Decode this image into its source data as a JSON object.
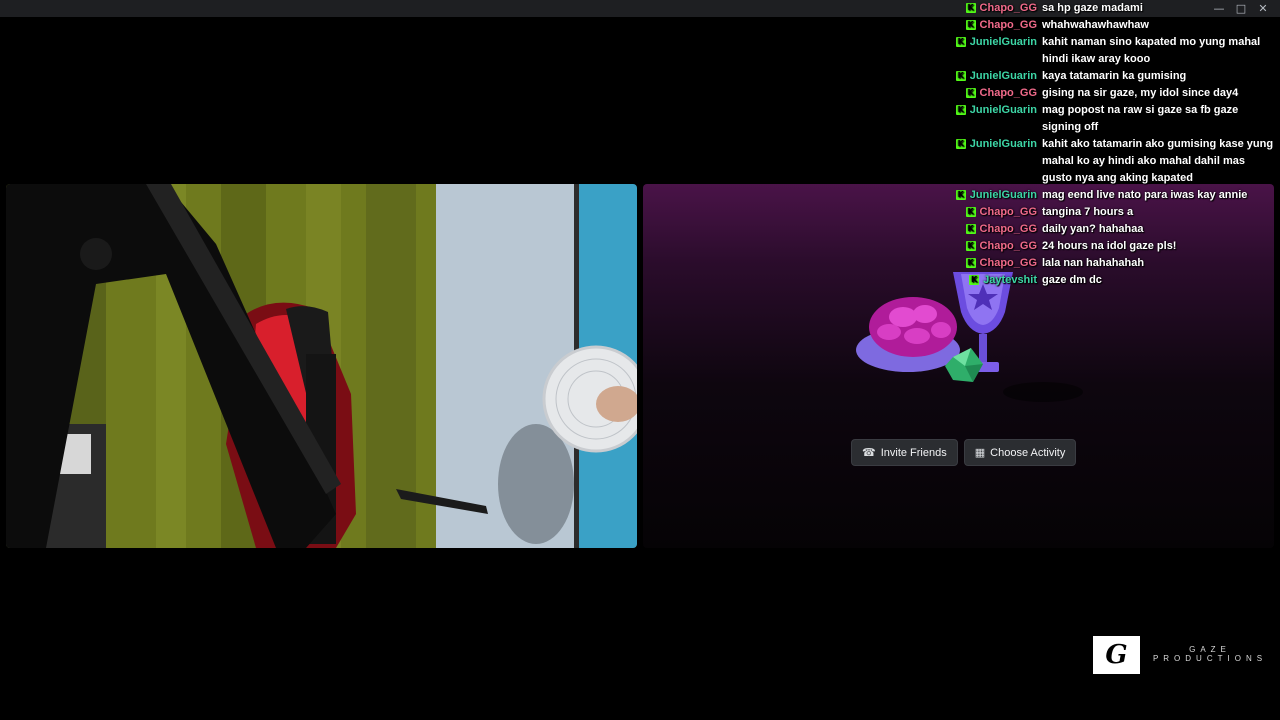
{
  "window": {
    "minimize_icon": "minimize-icon",
    "maximize_icon": "maximize-icon",
    "close_icon": "close-icon"
  },
  "activity": {
    "invite_label": "Invite Friends",
    "choose_label": "Choose Activity",
    "invite_icon": "add-friend-icon",
    "choose_icon": "gamepad-icon"
  },
  "chat": {
    "badge_icon": "kick-badge-icon",
    "colors": {
      "pink": "#f06a8a",
      "teal": "#3dd6a6",
      "badge": "#53fc18"
    },
    "messages": [
      {
        "user": "Chapo_GG",
        "color": "pink",
        "text": "sa hp gaze madami"
      },
      {
        "user": "Chapo_GG",
        "color": "pink",
        "text": "whahwahawhawhaw"
      },
      {
        "user": "JunielGuarin",
        "color": "teal",
        "text": "kahit naman sino kapated mo yung mahal hindi ikaw aray kooo"
      },
      {
        "user": "JunielGuarin",
        "color": "teal",
        "text": "kaya tatamarin ka gumising"
      },
      {
        "user": "Chapo_GG",
        "color": "pink",
        "text": "gising na sir gaze, my idol since day4"
      },
      {
        "user": "JunielGuarin",
        "color": "teal",
        "text": "mag popost na raw si gaze sa fb gaze signing off"
      },
      {
        "user": "JunielGuarin",
        "color": "teal",
        "text": "kahit ako tatamarin ako gumising kase yung mahal ko ay hindi ako mahal dahil mas gusto nya ang aking kapated"
      },
      {
        "user": "JunielGuarin",
        "color": "teal",
        "text": "mag eend live nato para iwas kay annie"
      },
      {
        "user": "Chapo_GG",
        "color": "pink",
        "text": "tangina 7 hours a"
      },
      {
        "user": "Chapo_GG",
        "color": "pink",
        "text": "daily yan? hahahaa"
      },
      {
        "user": "Chapo_GG",
        "color": "pink",
        "text": "24 hours na idol gaze pls!"
      },
      {
        "user": "Chapo_GG",
        "color": "pink",
        "text": "lala nan hahahahah"
      },
      {
        "user": "Jaytevshit",
        "color": "teal",
        "text": "gaze dm dc"
      }
    ]
  },
  "watermark": {
    "logo_letter": "G",
    "line1": "GAZE",
    "line2": "PRODUCTIONS"
  }
}
